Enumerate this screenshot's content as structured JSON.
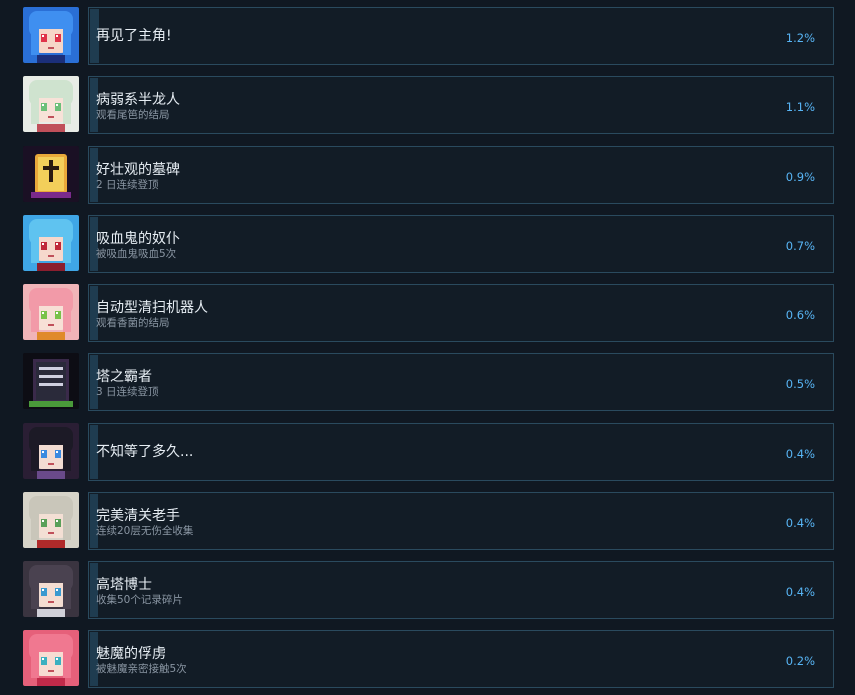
{
  "achievements": [
    {
      "title": "再见了主角!",
      "desc": "",
      "percent": "1.2%",
      "progress_fraction": 0.012,
      "icon": "blue-hair-girl-icon",
      "colors": {
        "bg": "#2a6fd6",
        "hair": "#3f8ff0",
        "skin": "#f6d6c8",
        "eye": "#e0334a",
        "accent": "#1b2f7a"
      }
    },
    {
      "title": "病弱系半龙人",
      "desc": "观看尾笆的结局",
      "percent": "1.1%",
      "progress_fraction": 0.011,
      "icon": "green-hair-girl-icon",
      "colors": {
        "bg": "#e8ece6",
        "hair": "#cfe3cf",
        "skin": "#f7e2d8",
        "eye": "#6cc07a",
        "accent": "#c0505a"
      }
    },
    {
      "title": "好壮观的墓碑",
      "desc": "2 日连续登顶",
      "percent": "0.9%",
      "progress_fraction": 0.009,
      "icon": "tombstone-icon",
      "colors": {
        "bg": "#1a1024",
        "hair": "#e9a93a",
        "skin": "#f3cf5a",
        "eye": "#2a1a10",
        "accent": "#7a2a8c"
      }
    },
    {
      "title": "吸血鬼的奴仆",
      "desc": "被吸血鬼吸血5次",
      "percent": "0.7%",
      "progress_fraction": 0.007,
      "icon": "vampire-girl-icon",
      "colors": {
        "bg": "#3fa6e6",
        "hair": "#5fc3f0",
        "skin": "#f6d8cc",
        "eye": "#c0283a",
        "accent": "#8b1e2e"
      }
    },
    {
      "title": "自动型清扫机器人",
      "desc": "观看香菌的结局",
      "percent": "0.6%",
      "progress_fraction": 0.006,
      "icon": "pink-hair-robot-girl-icon",
      "colors": {
        "bg": "#f0b4b8",
        "hair": "#f29aa8",
        "skin": "#f7e0d6",
        "eye": "#7ac24a",
        "accent": "#e08a2a"
      }
    },
    {
      "title": "塔之霸者",
      "desc": "3 日连续登顶",
      "percent": "0.5%",
      "progress_fraction": 0.005,
      "icon": "tower-monument-icon",
      "colors": {
        "bg": "#0d0d14",
        "hair": "#3a2a4a",
        "skin": "#2a2a3a",
        "eye": "#d0d0e0",
        "accent": "#4a9a3a"
      }
    },
    {
      "title": "不知等了多久...",
      "desc": "",
      "percent": "0.4%",
      "progress_fraction": 0.004,
      "icon": "dark-hair-girl-icon",
      "colors": {
        "bg": "#2a1e34",
        "hair": "#1c1a26",
        "skin": "#f2dcd2",
        "eye": "#3a8ae0",
        "accent": "#6a4a8a"
      }
    },
    {
      "title": "完美清关老手",
      "desc": "连续20层无伤全收集",
      "percent": "0.4%",
      "progress_fraction": 0.004,
      "icon": "gray-hair-girl-icon",
      "colors": {
        "bg": "#d6d3c8",
        "hair": "#c9c6ba",
        "skin": "#f3dfd4",
        "eye": "#5aa05a",
        "accent": "#b02a2a"
      }
    },
    {
      "title": "高塔博士",
      "desc": "收集50个记录碎片",
      "percent": "0.4%",
      "progress_fraction": 0.004,
      "icon": "horned-girl-icon",
      "colors": {
        "bg": "#3a3440",
        "hair": "#4a4250",
        "skin": "#f4ddd2",
        "eye": "#3a9ad0",
        "accent": "#d0d0d8"
      }
    },
    {
      "title": "魅魔的俘虏",
      "desc": "被魅魔亲密接触5次",
      "percent": "0.2%",
      "progress_fraction": 0.002,
      "icon": "succubus-girl-icon",
      "colors": {
        "bg": "#e6607a",
        "hair": "#f07890",
        "skin": "#f7dcd2",
        "eye": "#3ab0c0",
        "accent": "#c02a4a"
      }
    }
  ]
}
